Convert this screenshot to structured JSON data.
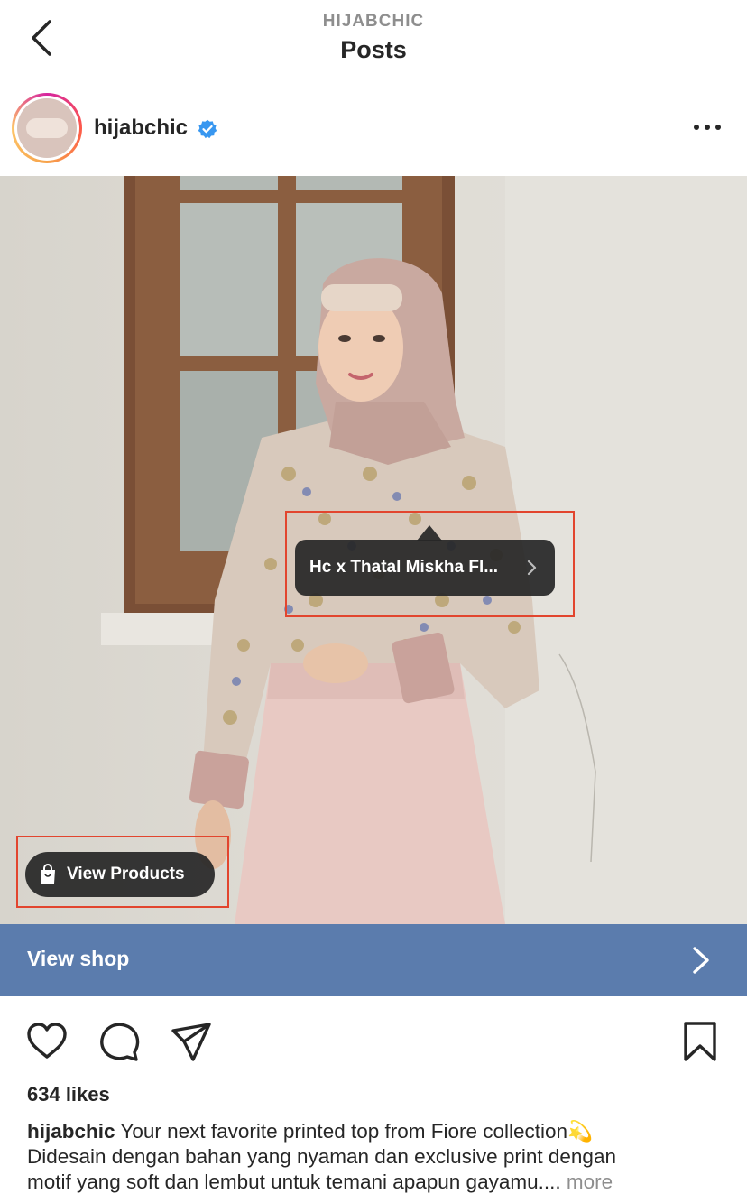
{
  "header": {
    "account_label": "HIJABCHIC",
    "title": "Posts"
  },
  "post": {
    "username": "hijabchic",
    "verified": true,
    "product_tag": "Hc x Thatal Miskha Fl...",
    "view_products_label": "View Products",
    "view_shop_label": "View shop",
    "likes": "634 likes",
    "caption_user": "hijabchic",
    "caption_line1": "Your next favorite printed top from Fiore collection💫",
    "caption_line2": "Didesain dengan bahan yang nyaman dan exclusive print dengan",
    "caption_line3": "motif yang soft dan lembut untuk temani apapun gayamu....",
    "more_label": "more"
  },
  "icons": {
    "back": "chevron-left-icon",
    "verified": "verified-badge-icon",
    "more": "more-dots-icon",
    "bag": "shopping-bag-icon",
    "like": "heart-icon",
    "comment": "comment-bubble-icon",
    "share": "paper-plane-icon",
    "save": "bookmark-icon"
  },
  "colors": {
    "view_shop_bar": "#5b7cad",
    "verified_blue": "#3897f0",
    "highlight": "#e2452e"
  }
}
